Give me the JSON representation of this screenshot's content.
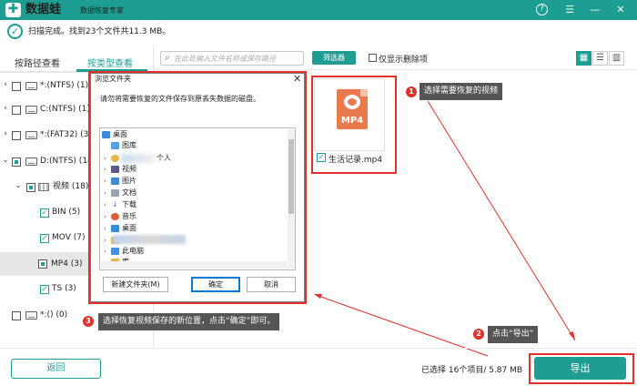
{
  "app": {
    "brand": "数据蛙",
    "subtitle": "数据恢复专家",
    "logo_glyph": "✚",
    "accent": "#1e9e92"
  },
  "window_controls": {
    "help": "?",
    "menu": "☰",
    "minimize": "—",
    "close": "✕"
  },
  "status": {
    "check": "✓",
    "text": "扫描完成。找到23个文件共11.3 MB。"
  },
  "tabs": [
    {
      "label": "按路径查看"
    },
    {
      "label": "按类型查看"
    }
  ],
  "tree": {
    "items": [
      {
        "label": "*:(NTFS) (1)"
      },
      {
        "label": "C:(NTFS) (1)"
      },
      {
        "label": "*:(FAT32) (3)"
      },
      {
        "label": "D:(NTFS) (18)"
      },
      {
        "label": "视频 (18)"
      },
      {
        "label": "BIN (5)"
      },
      {
        "label": "MOV (7)"
      },
      {
        "label": "MP4 (3)"
      },
      {
        "label": "TS (3)"
      },
      {
        "label": "*:() (0)"
      }
    ]
  },
  "toolbar": {
    "search_placeholder": "在此处输入文件名称或保存路径",
    "filter_button": "筛选器",
    "only_deleted": "仅显示删除项",
    "view_grid": "▦",
    "view_list": "☰",
    "view_detail": "▥"
  },
  "file": {
    "type_label": "MP4",
    "name": "生活记录.mp4"
  },
  "dialog": {
    "title": "浏览文件夹",
    "close": "✕",
    "description": "请勿将需要恢复的文件保存到原丢失数据的磁盘。",
    "folders": [
      {
        "label": "桌面",
        "arrow": ""
      },
      {
        "label": "图库",
        "arrow": ""
      },
      {
        "label": "个人",
        "arrow": "›"
      },
      {
        "label": "视频",
        "arrow": "›"
      },
      {
        "label": "图片",
        "arrow": "›"
      },
      {
        "label": "文档",
        "arrow": "›"
      },
      {
        "label": "下载",
        "arrow": "›"
      },
      {
        "label": "音乐",
        "arrow": "›"
      },
      {
        "label": "桌面",
        "arrow": "›"
      },
      {
        "label": "",
        "arrow": "›"
      },
      {
        "label": "此电脑",
        "arrow": "›"
      },
      {
        "label": "库",
        "arrow": "›"
      }
    ],
    "new_folder": "新建文件夹(M)",
    "ok": "确定",
    "cancel": "取消"
  },
  "callouts": [
    {
      "num": "1",
      "text": "选择需要恢复的视频"
    },
    {
      "num": "2",
      "text": "点击“导出”"
    },
    {
      "num": "3",
      "text": "选择恢复视频保存的新位置，点击“确定”即可。"
    }
  ],
  "footer": {
    "back": "返回",
    "selected_info": "已选择 16个项目/ 5.87 MB",
    "export": "导出"
  },
  "colors": {
    "teal": "#1e9e92",
    "red": "#e0312c",
    "callout_bg": "#555555",
    "mp4_orange": "#e87a4e"
  }
}
